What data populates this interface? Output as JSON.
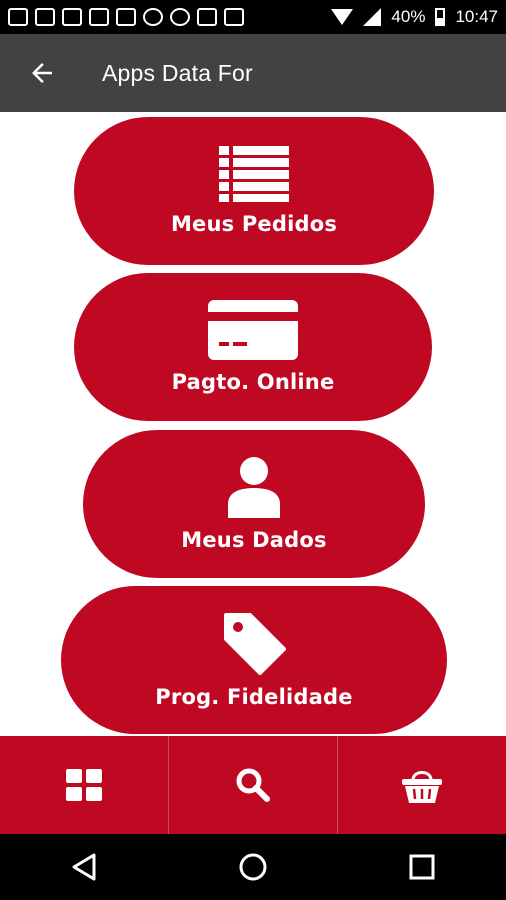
{
  "status_bar": {
    "battery": "40%",
    "time": "10:47",
    "notification_icons": [
      "chat-icon",
      "facebook-icon",
      "image-icon",
      "mail-icon",
      "mail-icon",
      "whatsapp-icon",
      "whatsapp-icon",
      "instagram-icon",
      "news-icon"
    ]
  },
  "app_bar": {
    "title": "Apps Data For",
    "back_icon": "arrow-back-icon"
  },
  "menu": [
    {
      "label": "Meus Pedidos",
      "icon": "list-icon"
    },
    {
      "label": "Pagto. Online",
      "icon": "credit-card-icon"
    },
    {
      "label": "Meus Dados",
      "icon": "user-icon"
    },
    {
      "label": "Prog. Fidelidade",
      "icon": "tag-icon"
    }
  ],
  "bottom_nav": [
    {
      "icon": "grid-icon"
    },
    {
      "icon": "search-icon"
    },
    {
      "icon": "basket-icon"
    }
  ],
  "system_nav": [
    "back-triangle-icon",
    "home-circle-icon",
    "recents-square-icon"
  ],
  "colors": {
    "primary": "#bf0923",
    "app_bar": "#424242",
    "system_bar": "#000000"
  }
}
